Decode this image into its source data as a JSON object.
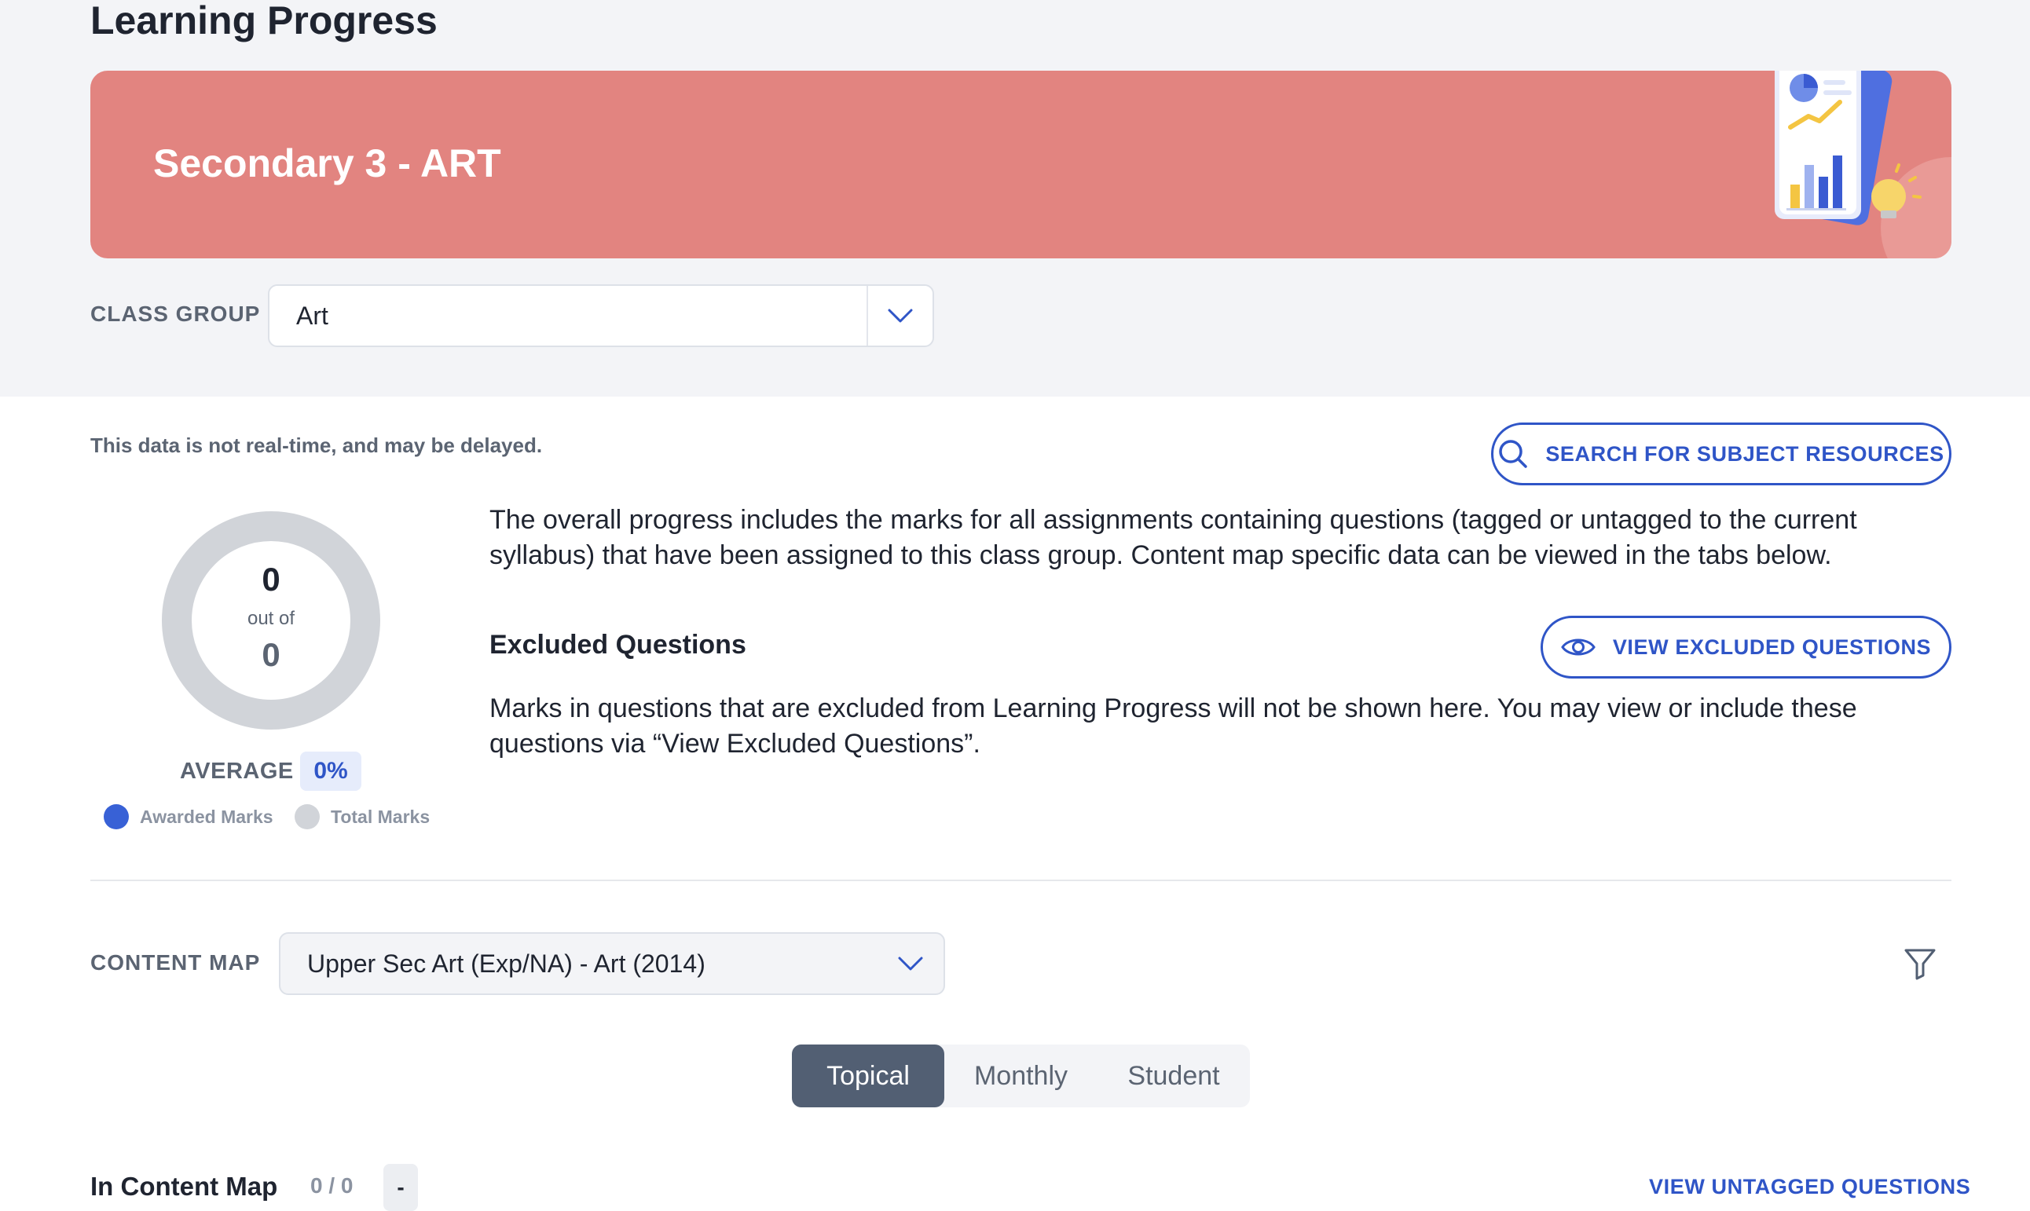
{
  "page": {
    "title": "Learning Progress"
  },
  "banner": {
    "title": "Secondary 3 - ART"
  },
  "class_group": {
    "label": "CLASS GROUP",
    "selected": "Art"
  },
  "notice": "This data is not real-time, and may be delayed.",
  "search_button": {
    "label": "SEARCH FOR SUBJECT RESOURCES",
    "icon": "search-icon"
  },
  "progress": {
    "awarded": "0",
    "out_of_label": "out of",
    "total": "0",
    "average_label": "AVERAGE",
    "average_value": "0%",
    "awarded_fraction": 0
  },
  "legend": {
    "awarded": "Awarded Marks",
    "total": "Total Marks"
  },
  "colors": {
    "banner": "#e28480",
    "accent": "#2f55c7",
    "awarded": "#3861d6",
    "total": "#d1d4d9",
    "active_tab": "#525f73"
  },
  "overview_text": "The overall progress includes the marks for all assignments containing questions (tagged or untagged to the current syllabus) that have been assigned to this class group. Content map specific data can be viewed in the tabs below.",
  "excluded": {
    "title": "Excluded Questions",
    "button_label": "VIEW EXCLUDED QUESTIONS",
    "icon": "eye-icon",
    "description": "Marks in questions that are excluded from Learning Progress will not be shown here. You may view or include these questions via “View Excluded Questions”."
  },
  "content_map": {
    "label": "CONTENT MAP",
    "selected": "Upper Sec Art (Exp/NA) - Art (2014)"
  },
  "tabs": [
    {
      "label": "Topical",
      "active": true
    },
    {
      "label": "Monthly",
      "active": false
    },
    {
      "label": "Student",
      "active": false
    }
  ],
  "in_content_map": {
    "title": "In Content Map",
    "count": "0 / 0",
    "badge": "-",
    "link_label": "VIEW UNTAGGED QUESTIONS"
  }
}
